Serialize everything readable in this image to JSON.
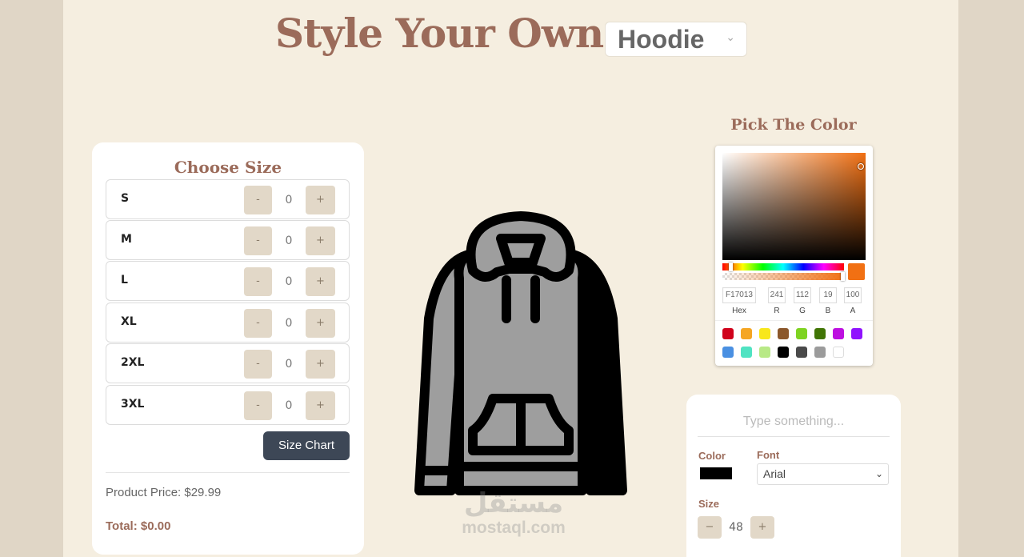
{
  "header": {
    "title": "Style Your Own",
    "product": "Hoodie"
  },
  "size_panel": {
    "title": "Choose Size",
    "sizes": [
      {
        "label": "S",
        "qty": "0"
      },
      {
        "label": "M",
        "qty": "0"
      },
      {
        "label": "L",
        "qty": "0"
      },
      {
        "label": "XL",
        "qty": "0"
      },
      {
        "label": "2XL",
        "qty": "0"
      },
      {
        "label": "3XL",
        "qty": "0"
      }
    ],
    "minus": "-",
    "plus": "+",
    "size_chart_label": "Size Chart",
    "price": "Product Price: $29.99",
    "total": "Total: $0.00"
  },
  "color_picker": {
    "title": "Pick The Color",
    "hex": "F17013",
    "r": "241",
    "g": "112",
    "b": "19",
    "a": "100",
    "labels": {
      "hex": "Hex",
      "r": "R",
      "g": "G",
      "b": "B",
      "a": "A"
    },
    "presets": [
      "#d0021b",
      "#f5a623",
      "#f8e71c",
      "#8b572a",
      "#7ed321",
      "#417505",
      "#bd10e0",
      "#9013fe",
      "#4a90e2",
      "#50e3c2",
      "#b8e986",
      "#000000",
      "#4a4a4a",
      "#9b9b9b",
      "#ffffff"
    ]
  },
  "text_options": {
    "placeholder": "Type something...",
    "color_label": "Color",
    "font_label": "Font",
    "font_value": "Arial",
    "size_label": "Size",
    "size_value": "48",
    "minus": "−",
    "plus": "+"
  },
  "watermark": {
    "arabic": "مستقل",
    "latin": "mostaql.com"
  },
  "colors": {
    "accent": "#9b6b5a",
    "button_dark": "#3d4756",
    "stepper": "#e2d8c8",
    "hoodie_fill": "#9e9e9e",
    "selected_color": "#f17013"
  }
}
